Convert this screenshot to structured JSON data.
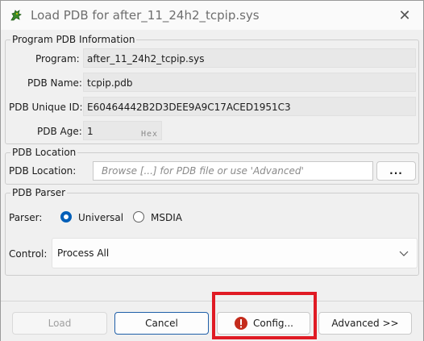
{
  "window": {
    "title": "Load PDB for after_11_24h2_tcpip.sys",
    "close_symbol": "✕"
  },
  "program_info": {
    "legend": "Program PDB Information",
    "program_label": "Program:",
    "program_value": "after_11_24h2_tcpip.sys",
    "pdb_name_label": "PDB Name:",
    "pdb_name_value": "tcpip.pdb",
    "pdb_uid_label": "PDB Unique ID:",
    "pdb_uid_value": "E60464442B2D3DEE9A9C17ACED1951C3",
    "pdb_age_label": "PDB Age:",
    "pdb_age_value": "1",
    "pdb_age_suffix": "Hex"
  },
  "pdb_location": {
    "legend": "PDB Location",
    "label": "PDB Location:",
    "placeholder": "Browse [...] for PDB file or use 'Advanced'",
    "browse_label": "..."
  },
  "pdb_parser": {
    "legend": "PDB Parser",
    "parser_label": "Parser:",
    "option_universal": "Universal",
    "option_msdia": "MSDIA",
    "selected": "Universal",
    "control_label": "Control:",
    "control_value": "Process All"
  },
  "buttons": {
    "load": "Load",
    "cancel": "Cancel",
    "config": "Config...",
    "advanced": "Advanced >>"
  },
  "colors": {
    "accent": "#005fb8",
    "highlight": "#e01b24",
    "error_icon": "#c42b1c"
  }
}
